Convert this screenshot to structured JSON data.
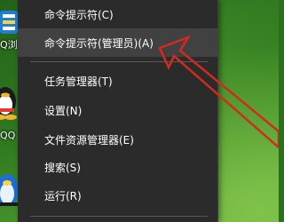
{
  "desktop": {
    "icons": [
      {
        "label": "Q浏",
        "icon": "browser-shortcut-icon"
      },
      {
        "label": "QQ",
        "icon": "qq-penguin-icon"
      },
      {
        "label": "",
        "icon": "qq-shortcut-icon"
      }
    ]
  },
  "context_menu": {
    "items": [
      {
        "label": "命令提示符(C)",
        "icon": ""
      },
      {
        "label": "命令提示符(管理员)(A)",
        "icon": ""
      },
      {
        "label": "任务管理器(T)",
        "icon": ""
      },
      {
        "label": "设置(N)",
        "icon": ""
      },
      {
        "label": "文件资源管理器(E)",
        "icon": ""
      },
      {
        "label": "搜索(S)",
        "icon": ""
      },
      {
        "label": "运行(R)",
        "icon": ""
      }
    ],
    "highlighted_item": "命令提示符(管理员)(A)"
  },
  "annotation": {
    "icon": "red-arrow-icon",
    "color": "#d42a1e"
  },
  "colors": {
    "menu_background": "#2b2b2b",
    "menu_hover": "#414141",
    "separator": "#5a5a5a",
    "arrow": "#d42a1e"
  }
}
